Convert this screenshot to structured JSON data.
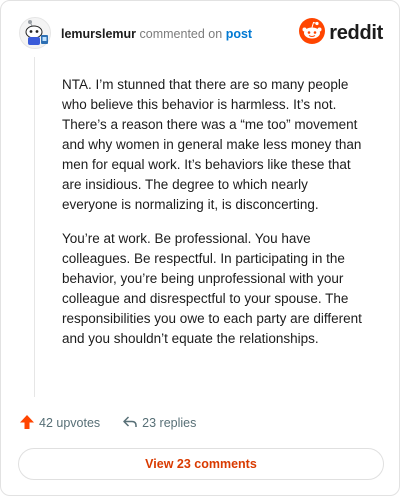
{
  "header": {
    "username": "lemurslemur",
    "action_text": "commented on",
    "post_link": "post",
    "brand_word": "reddit",
    "brand_color": "#ff4500",
    "avatar_icon": "snoo-avatar-icon"
  },
  "comment": {
    "paragraphs": [
      "NTA. I’m stunned that there are so many people who believe this behavior is harmless. It’s not. There’s a reason there was a “me too” movement and why women in general make less money than men for equal work. It’s behaviors like these that are insidious. The degree to which nearly everyone is normalizing it, is disconcerting.",
      "You’re at work. Be professional. You have colleagues. Be respectful. In participating in the behavior, you’re being unprofessional with your colleague and disrespectful to your spouse. The responsibilities you owe to each party are different and you shouldn’t equate the relationships."
    ]
  },
  "actions": {
    "upvotes": "42 upvotes",
    "replies": "23 replies",
    "upvote_icon": "upvote-arrow-icon",
    "reply_icon": "reply-arrow-icon",
    "upvote_color": "#ff4500"
  },
  "footer": {
    "view_label": "View 23 comments",
    "view_color": "#d93a00"
  }
}
